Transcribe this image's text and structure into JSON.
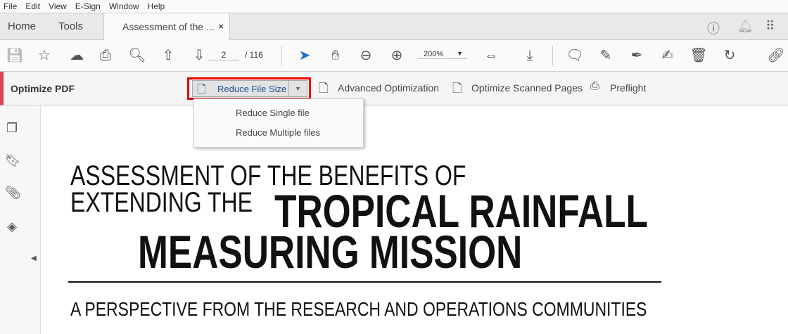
{
  "menu": [
    "File",
    "Edit",
    "View",
    "E-Sign",
    "Window",
    "Help"
  ],
  "tabs": {
    "home": "Home",
    "tools": "Tools",
    "document": "Assessment of the ...",
    "close": "×"
  },
  "toolbar": {
    "page_current": "2",
    "page_total": "/  116",
    "zoom": "200%"
  },
  "optimize": {
    "title": "Optimize PDF",
    "reduce": "Reduce File Size",
    "advanced": "Advanced Optimization",
    "scanned": "Optimize Scanned Pages",
    "preflight": "Preflight"
  },
  "dropdown": [
    "Reduce Single file",
    "Reduce Multiple files"
  ],
  "document": {
    "line1": "ASSESSMENT OF THE BENEFITS OF",
    "line2a": "EXTENDING THE",
    "line2b": "TROPICAL RAINFALL",
    "line3": "MEASURING MISSION",
    "subtitle": "A PERSPECTIVE FROM THE RESEARCH AND OPERATIONS COMMUNITIES"
  },
  "colors": {
    "accent": "#e0404f",
    "highlight": "#ee0000",
    "select": "#1e6fd0"
  }
}
